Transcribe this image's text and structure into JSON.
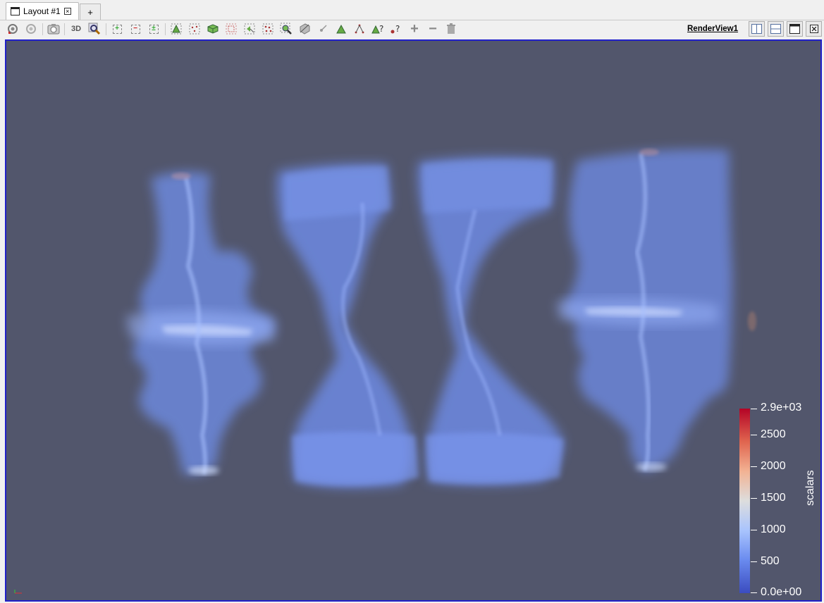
{
  "tabs": [
    {
      "label": "Layout #1",
      "close": "☒"
    },
    {
      "label": "+"
    }
  ],
  "toolbar": {
    "buttons": [
      {
        "name": "reset-camera-closest-icon"
      },
      {
        "name": "reset-camera-icon"
      },
      {
        "name": "capture-screenshot-icon"
      },
      {
        "name": "toggle-3d-button",
        "label": "3D"
      },
      {
        "name": "zoom-to-box-icon"
      },
      {
        "name": "select-cells-on-icon"
      },
      {
        "name": "select-points-on-icon"
      },
      {
        "name": "select-cells-through-icon"
      },
      {
        "name": "select-points-through-icon"
      },
      {
        "name": "select-cells-polygon-icon"
      },
      {
        "name": "select-points-polygon-icon"
      },
      {
        "name": "select-blocks-icon"
      },
      {
        "name": "interactive-select-cells-icon"
      },
      {
        "name": "interactive-select-points-icon"
      },
      {
        "name": "hover-cells-icon"
      },
      {
        "name": "hover-points-icon"
      },
      {
        "name": "grow-selection-icon"
      },
      {
        "name": "shrink-selection-icon"
      },
      {
        "name": "clear-selection-icon"
      }
    ],
    "view_label": "RenderView1",
    "three_d_label": "3D"
  },
  "render_view": {
    "background": "#52566c",
    "border_color": "#2020c8"
  },
  "color_legend": {
    "title": "scalars",
    "max_label": "2.9e+03",
    "min_label": "0.0e+00",
    "ticks": [
      "2500",
      "2000",
      "1500",
      "1000",
      "500"
    ],
    "colormap": [
      "#b40426",
      "#e0654f",
      "#f2b293",
      "#dddddd",
      "#a9c4fd",
      "#6a8bef",
      "#3b4cc0"
    ]
  }
}
